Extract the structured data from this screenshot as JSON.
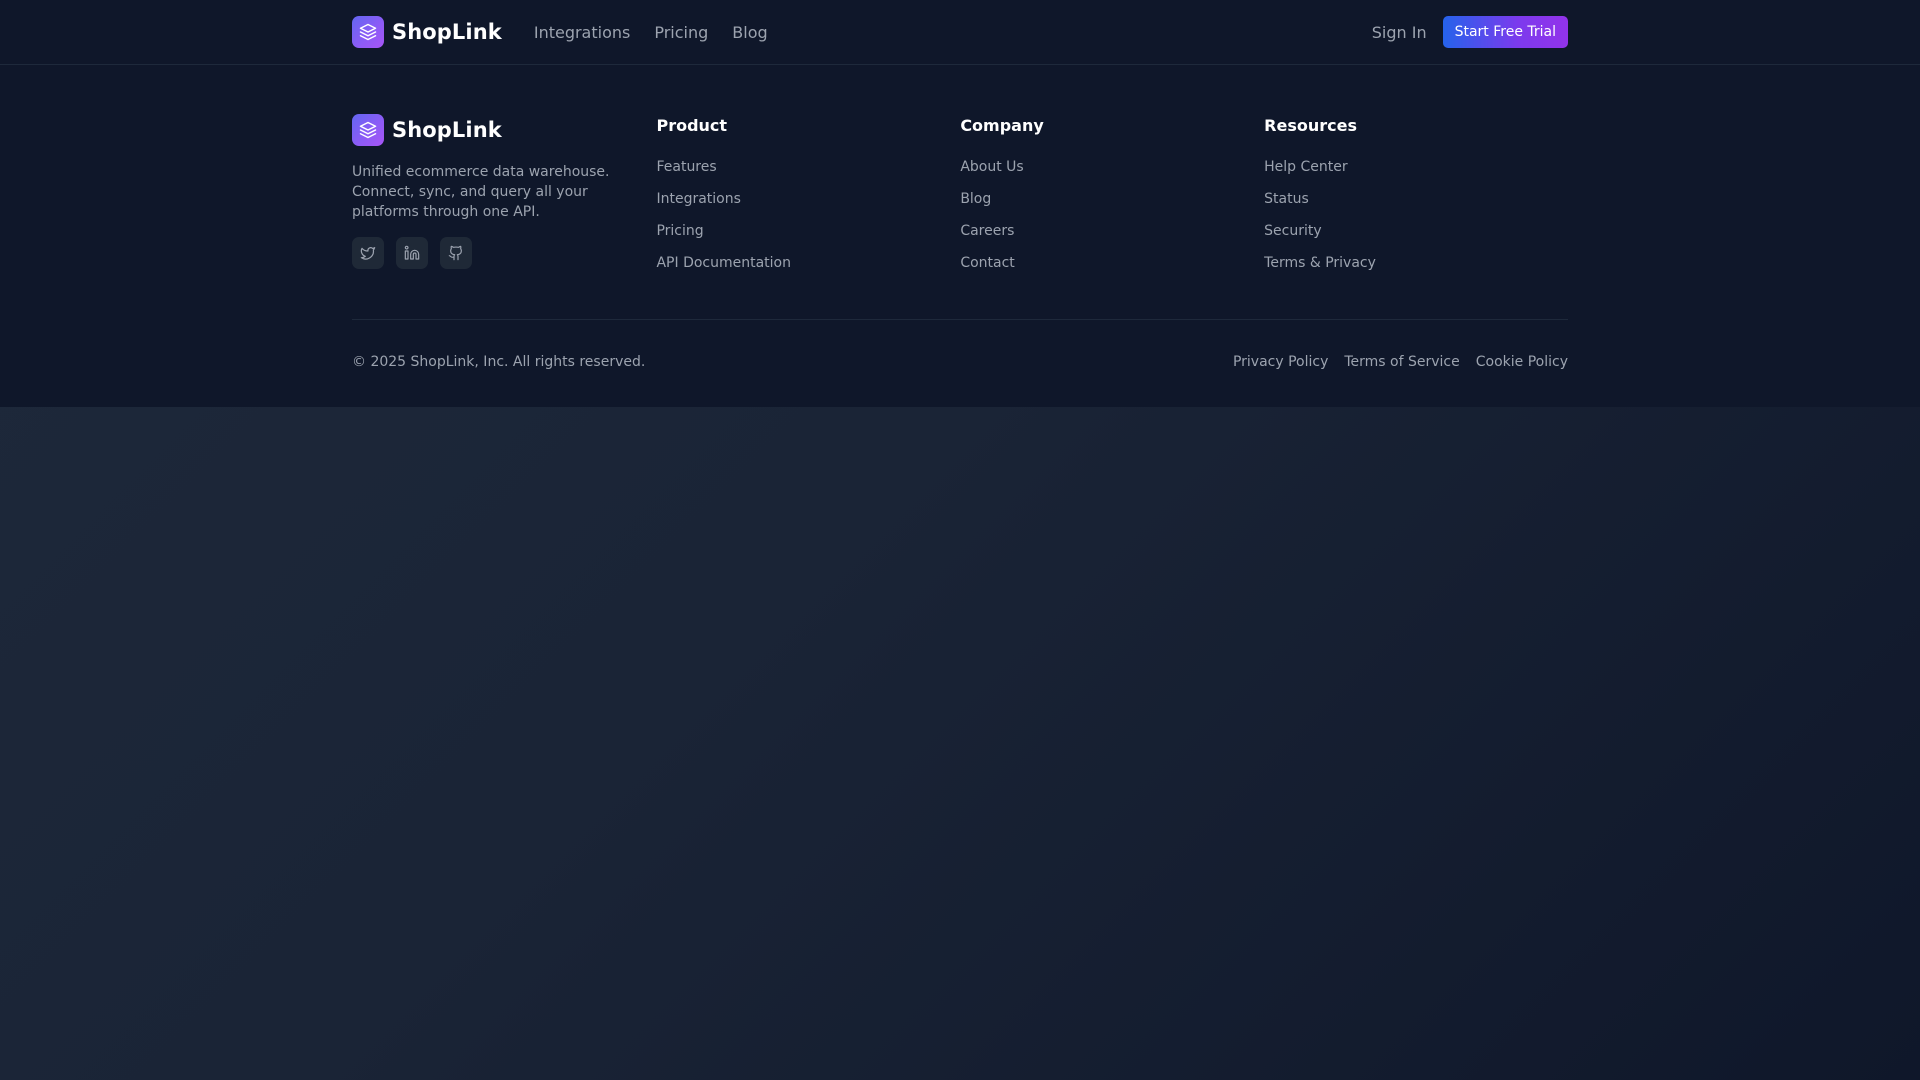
{
  "nav": {
    "brand": "ShopLink",
    "links": [
      "Integrations",
      "Pricing",
      "Blog"
    ],
    "signin": "Sign In",
    "cta": "Start Free Trial"
  },
  "footer": {
    "brand": "ShopLink",
    "description": "Unified ecommerce data warehouse. Connect, sync, and query all your platforms through one API.",
    "socials": [
      "twitter-icon",
      "linkedin-icon",
      "github-icon"
    ],
    "columns": [
      {
        "title": "Product",
        "links": [
          "Features",
          "Integrations",
          "Pricing",
          "API Documentation"
        ]
      },
      {
        "title": "Company",
        "links": [
          "About Us",
          "Blog",
          "Careers",
          "Contact"
        ]
      },
      {
        "title": "Resources",
        "links": [
          "Help Center",
          "Status",
          "Security",
          "Terms & Privacy"
        ]
      }
    ],
    "copyright": "© 2025 ShopLink, Inc. All rights reserved.",
    "legal": [
      "Privacy Policy",
      "Terms of Service",
      "Cookie Policy"
    ]
  },
  "colors": {
    "navy": "#0f172a",
    "brand_gradient_start": "#6366f1",
    "brand_gradient_end": "#a855f7",
    "cta_gradient_start": "#2563eb",
    "cta_gradient_end": "#9333ea",
    "muted_text": "#9ca3af"
  }
}
